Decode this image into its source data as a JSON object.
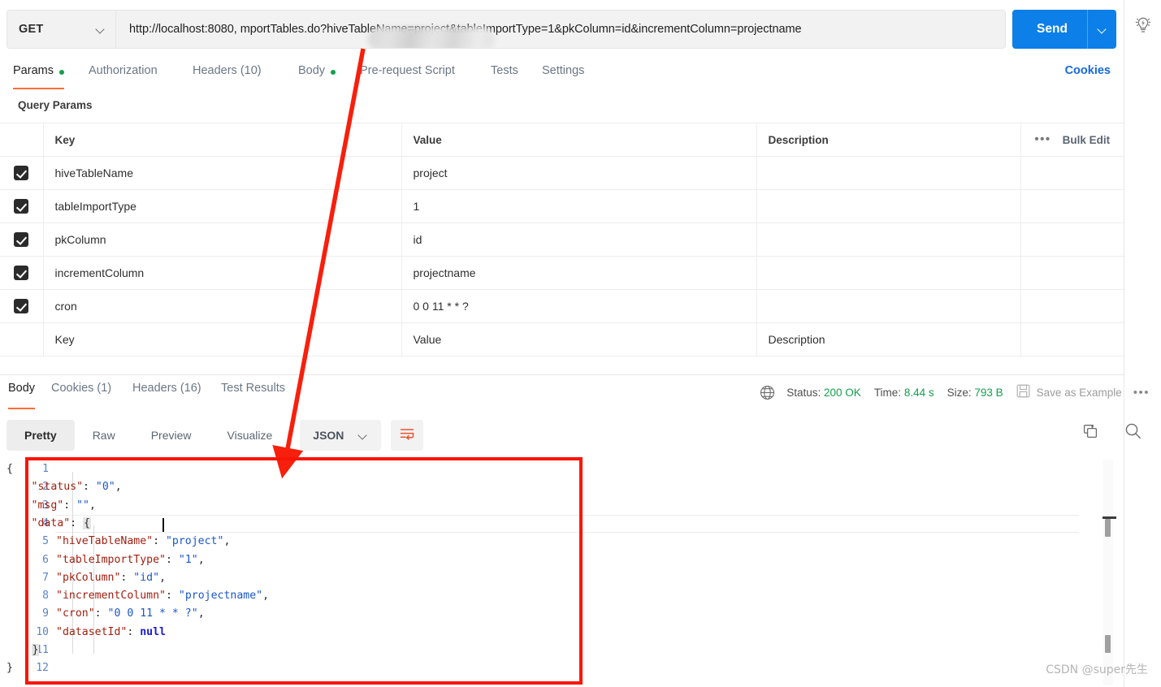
{
  "request": {
    "method": "GET",
    "url": "http://localhost:8080,                    mportTables.do?hiveTableName=project&tableImportType=1&pkColumn=id&incrementColumn=projectname",
    "send_label": "Send",
    "bulb_icon": "lightbulb-bolt-icon",
    "cookies_link": "Cookies",
    "tabs": [
      {
        "label": "Params",
        "dot": true
      },
      {
        "label": "Authorization",
        "dot": false
      },
      {
        "label": "Headers (10)",
        "dot": false
      },
      {
        "label": "Body",
        "dot": true
      },
      {
        "label": "Pre-request Script",
        "dot": false
      },
      {
        "label": "Tests",
        "dot": false
      },
      {
        "label": "Settings",
        "dot": false
      }
    ],
    "active_tab": "Params"
  },
  "query_params": {
    "section_title": "Query Params",
    "columns": [
      "Key",
      "Value",
      "Description"
    ],
    "bulk_edit_label": "Bulk Edit",
    "more_dots": "•••",
    "rows": [
      {
        "checked": true,
        "key": "hiveTableName",
        "value": "project",
        "description": ""
      },
      {
        "checked": true,
        "key": "tableImportType",
        "value": "1",
        "description": ""
      },
      {
        "checked": true,
        "key": "pkColumn",
        "value": "id",
        "description": ""
      },
      {
        "checked": true,
        "key": "incrementColumn",
        "value": "projectname",
        "description": ""
      },
      {
        "checked": true,
        "key": "cron",
        "value": "0 0 11 * * ?",
        "description": ""
      }
    ],
    "placeholder_row": {
      "key": "Key",
      "value": "Value",
      "description": "Description"
    }
  },
  "response": {
    "tabs": [
      "Body",
      "Cookies (1)",
      "Headers (16)",
      "Test Results"
    ],
    "active_tab": "Body",
    "status_label": "Status:",
    "status_value": "200 OK",
    "time_label": "Time:",
    "time_value": "8.44 s",
    "size_label": "Size:",
    "size_value": "793 B",
    "save_as_example": "Save as Example",
    "more_dots": "•••",
    "globe_icon": "globe-icon",
    "save_icon": "floppy-disk-icon",
    "view_modes": [
      "Pretty",
      "Raw",
      "Preview",
      "Visualize"
    ],
    "active_view": "Pretty",
    "format": "JSON",
    "wrap_icon": "word-wrap-icon",
    "copy_icon": "copy-icon",
    "search_icon": "search-icon",
    "body_lines": [
      {
        "n": 1,
        "indent": 0,
        "tokens": [
          {
            "t": "brace",
            "v": "{"
          }
        ]
      },
      {
        "n": 2,
        "indent": 1,
        "tokens": [
          {
            "t": "k",
            "v": "\"status\""
          },
          {
            "t": "p",
            "v": ": "
          },
          {
            "t": "s",
            "v": "\"0\""
          },
          {
            "t": "p",
            "v": ","
          }
        ]
      },
      {
        "n": 3,
        "indent": 1,
        "tokens": [
          {
            "t": "k",
            "v": "\"msg\""
          },
          {
            "t": "p",
            "v": ": "
          },
          {
            "t": "s",
            "v": "\"\""
          },
          {
            "t": "p",
            "v": ","
          }
        ]
      },
      {
        "n": 4,
        "indent": 1,
        "tokens": [
          {
            "t": "k",
            "v": "\"data\""
          },
          {
            "t": "p",
            "v": ": "
          },
          {
            "t": "fold",
            "v": "{"
          }
        ]
      },
      {
        "n": 5,
        "indent": 2,
        "tokens": [
          {
            "t": "k",
            "v": "\"hiveTableName\""
          },
          {
            "t": "p",
            "v": ": "
          },
          {
            "t": "s",
            "v": "\"project\""
          },
          {
            "t": "p",
            "v": ","
          }
        ]
      },
      {
        "n": 6,
        "indent": 2,
        "tokens": [
          {
            "t": "k",
            "v": "\"tableImportType\""
          },
          {
            "t": "p",
            "v": ": "
          },
          {
            "t": "s",
            "v": "\"1\""
          },
          {
            "t": "p",
            "v": ","
          }
        ]
      },
      {
        "n": 7,
        "indent": 2,
        "tokens": [
          {
            "t": "k",
            "v": "\"pkColumn\""
          },
          {
            "t": "p",
            "v": ": "
          },
          {
            "t": "s",
            "v": "\"id\""
          },
          {
            "t": "p",
            "v": ","
          }
        ]
      },
      {
        "n": 8,
        "indent": 2,
        "tokens": [
          {
            "t": "k",
            "v": "\"incrementColumn\""
          },
          {
            "t": "p",
            "v": ": "
          },
          {
            "t": "s",
            "v": "\"projectname\""
          },
          {
            "t": "p",
            "v": ","
          }
        ]
      },
      {
        "n": 9,
        "indent": 2,
        "tokens": [
          {
            "t": "k",
            "v": "\"cron\""
          },
          {
            "t": "p",
            "v": ": "
          },
          {
            "t": "s",
            "v": "\"0 0 11 * * ?\""
          },
          {
            "t": "p",
            "v": ","
          }
        ]
      },
      {
        "n": 10,
        "indent": 2,
        "tokens": [
          {
            "t": "k",
            "v": "\"datasetId\""
          },
          {
            "t": "p",
            "v": ": "
          },
          {
            "t": "nul",
            "v": "null"
          }
        ]
      },
      {
        "n": 11,
        "indent": 1,
        "tokens": [
          {
            "t": "fold",
            "v": "}"
          }
        ]
      },
      {
        "n": 12,
        "indent": 0,
        "tokens": [
          {
            "t": "brace",
            "v": "}"
          }
        ]
      }
    ]
  },
  "annotations": {
    "arrow_color": "#f81f0d",
    "box_color": "#fb1505",
    "watermark": "CSDN @super先生"
  }
}
